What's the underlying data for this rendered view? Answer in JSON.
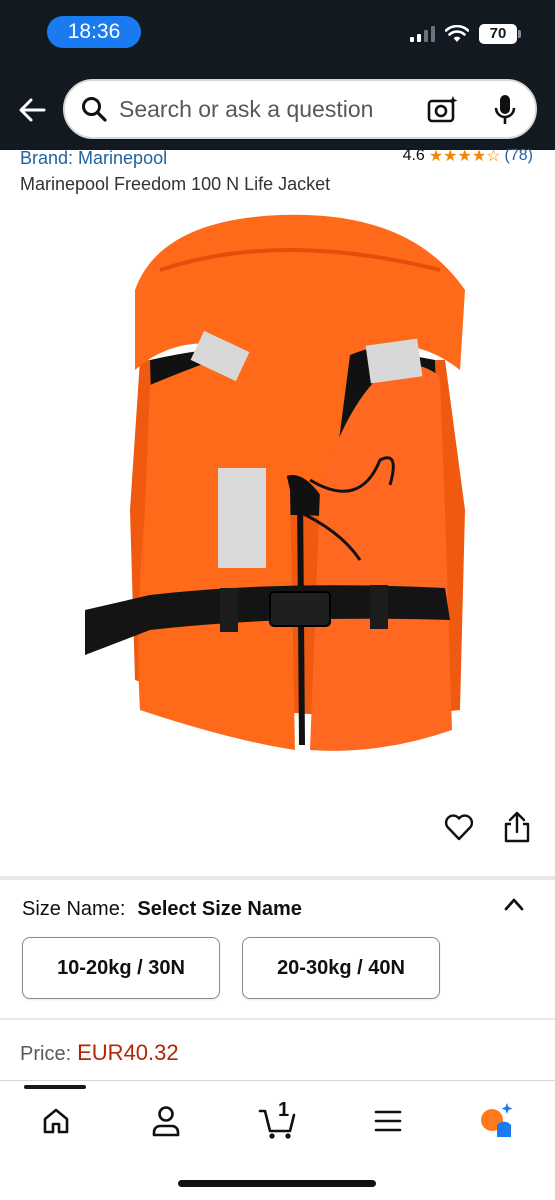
{
  "status_bar": {
    "time": "18:36",
    "battery": "70"
  },
  "search": {
    "placeholder": "Search or ask a question"
  },
  "product": {
    "brand": "Brand: Marinepool",
    "rating": "4.6",
    "stars": "★★★★☆",
    "review_count": "(78)",
    "title": "Marinepool Freedom 100 N Life Jacket"
  },
  "size": {
    "label": "Size Name:",
    "selected": "Select Size Name",
    "options": [
      "10-20kg / 30N",
      "20-30kg / 40N"
    ]
  },
  "price": {
    "label": "Price:",
    "value": "EUR40.32"
  },
  "bottom_nav": {
    "cart_count": "1"
  },
  "colors": {
    "header_bg": "#131921",
    "time_pill": "#1a7bf0",
    "link_blue": "#2162a1",
    "price_red": "#b12704",
    "star_orange": "#f08804",
    "jacket_orange": "#ff6a1a"
  }
}
